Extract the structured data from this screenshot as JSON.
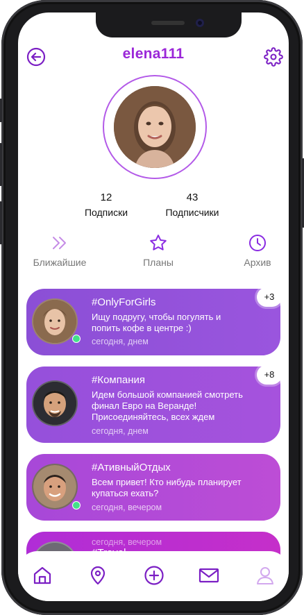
{
  "header": {
    "username": "elena111",
    "back_icon": "arrow-left-circle-icon",
    "settings_icon": "gear-icon"
  },
  "stats": {
    "following_count": "12",
    "following_label": "Подписки",
    "followers_count": "43",
    "followers_label": "Подписчики"
  },
  "tabs": [
    {
      "label": "Ближайшие",
      "icon": "double-chevron-right-icon"
    },
    {
      "label": "Планы",
      "icon": "star-icon"
    },
    {
      "label": "Архив",
      "icon": "clock-icon"
    }
  ],
  "cards": [
    {
      "title": "#OnlyForGirls",
      "text": "Ищу подругу, чтобы погулять и попить кофе в центре :)",
      "time": "сегодня, днем",
      "badge": "+3"
    },
    {
      "title": "#Компания",
      "text": "Идем большой компанией смотреть финал Евро на Веранде! Присоединяйтесь, всех ждем",
      "time": "сегодня, днем",
      "badge": "+8"
    },
    {
      "title": "#АтивныйОтдых",
      "text": "Всем привет! Кто нибудь планирует купаться ехать?",
      "time": "сегодня, вечером"
    },
    {
      "title": "#Travel",
      "time": "сегодня, вечером"
    }
  ],
  "colors": {
    "accent": "#9b27d8",
    "card_start": "#8b4fd6",
    "card_end": "#c52fca",
    "online": "#43e08a"
  },
  "bottom_nav": [
    {
      "icon": "home-icon"
    },
    {
      "icon": "map-pin-icon"
    },
    {
      "icon": "plus-circle-icon"
    },
    {
      "icon": "mail-icon"
    },
    {
      "icon": "profile-icon"
    }
  ]
}
